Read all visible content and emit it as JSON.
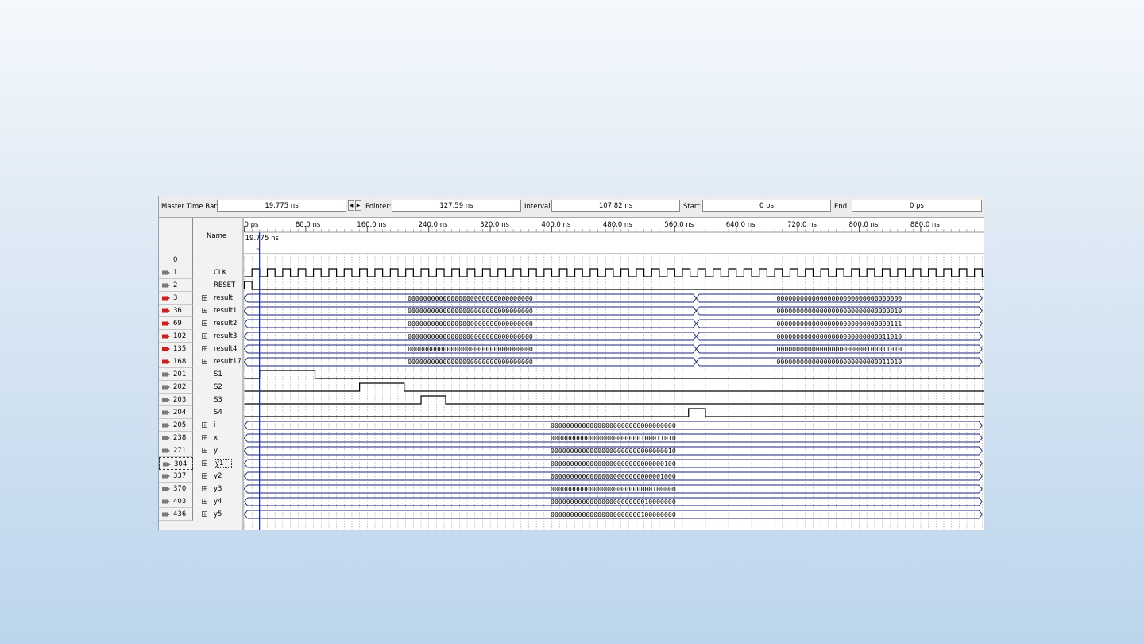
{
  "toolbar": {
    "master_label": "Master Time Bar:",
    "master_value": "19.775 ns",
    "pointer_label": "Pointer:",
    "pointer_value": "127.59 ns",
    "interval_label": "Interval:",
    "interval_value": "107.82 ns",
    "start_label": "Start:",
    "start_value": "0 ps",
    "end_label": "End:",
    "end_value": "0 ps"
  },
  "header": {
    "name_col": "Name",
    "cursor_label": "19.775 ns",
    "zero_row": "0"
  },
  "timeline": {
    "ticks": [
      "0 ps",
      "80.0 ns",
      "160.0 ns",
      "240.0 ns",
      "320.0 ns",
      "400.0 ns",
      "480.0 ns",
      "560.0 ns",
      "640.0 ns",
      "720.0 ns",
      "800.0 ns",
      "880.0 ns"
    ],
    "ns_per_tick": 80,
    "cursor_ns": 19.775,
    "clock_period_ns": 20
  },
  "signals": [
    {
      "idx": "1",
      "name": "CLK",
      "kind": "clock",
      "pin": "in"
    },
    {
      "idx": "2",
      "name": "RESET",
      "kind": "pulse",
      "pin": "in",
      "pulses": [
        [
          0,
          10
        ]
      ]
    },
    {
      "idx": "3",
      "name": "result",
      "kind": "bus",
      "pin": "out",
      "expand": true,
      "segments": [
        {
          "from": 0,
          "to": 588,
          "text": "00000000000000000000000000000000"
        },
        {
          "from": 588,
          "to": 960,
          "text": "00000000000000000000000000000000"
        }
      ]
    },
    {
      "idx": "36",
      "name": "result1",
      "kind": "bus",
      "pin": "out",
      "expand": true,
      "segments": [
        {
          "from": 0,
          "to": 588,
          "text": "00000000000000000000000000000000"
        },
        {
          "from": 588,
          "to": 960,
          "text": "00000000000000000000000000000010"
        }
      ]
    },
    {
      "idx": "69",
      "name": "result2",
      "kind": "bus",
      "pin": "out",
      "expand": true,
      "segments": [
        {
          "from": 0,
          "to": 588,
          "text": "00000000000000000000000000000000"
        },
        {
          "from": 588,
          "to": 960,
          "text": "00000000000000000000000000000111"
        }
      ]
    },
    {
      "idx": "102",
      "name": "result3",
      "kind": "bus",
      "pin": "out",
      "expand": true,
      "segments": [
        {
          "from": 0,
          "to": 588,
          "text": "00000000000000000000000000000000"
        },
        {
          "from": 588,
          "to": 960,
          "text": "00000000000000000000000000011010"
        }
      ]
    },
    {
      "idx": "135",
      "name": "result4",
      "kind": "bus",
      "pin": "out",
      "expand": true,
      "segments": [
        {
          "from": 0,
          "to": 588,
          "text": "00000000000000000000000000000000"
        },
        {
          "from": 588,
          "to": 960,
          "text": "00000000000000000000000100011010"
        }
      ]
    },
    {
      "idx": "168",
      "name": "result17",
      "kind": "bus",
      "pin": "out",
      "expand": true,
      "segments": [
        {
          "from": 0,
          "to": 588,
          "text": "00000000000000000000000000000000"
        },
        {
          "from": 588,
          "to": 960,
          "text": "00000000000000000000000000011010"
        }
      ]
    },
    {
      "idx": "201",
      "name": "S1",
      "kind": "pulse",
      "pin": "in",
      "pulses": [
        [
          20,
          92
        ]
      ]
    },
    {
      "idx": "202",
      "name": "S2",
      "kind": "pulse",
      "pin": "in",
      "pulses": [
        [
          150,
          208
        ]
      ]
    },
    {
      "idx": "203",
      "name": "S3",
      "kind": "pulse",
      "pin": "in",
      "pulses": [
        [
          230,
          262
        ]
      ]
    },
    {
      "idx": "204",
      "name": "S4",
      "kind": "pulse",
      "pin": "in",
      "pulses": [
        [
          578,
          600
        ]
      ]
    },
    {
      "idx": "205",
      "name": "i",
      "kind": "bus",
      "pin": "in",
      "expand": true,
      "segments": [
        {
          "from": 0,
          "to": 960,
          "text": "00000000000000000000000000000000"
        }
      ]
    },
    {
      "idx": "238",
      "name": "x",
      "kind": "bus",
      "pin": "in",
      "expand": true,
      "segments": [
        {
          "from": 0,
          "to": 960,
          "text": "00000000000000000000000100011010"
        }
      ]
    },
    {
      "idx": "271",
      "name": "y",
      "kind": "bus",
      "pin": "in",
      "expand": true,
      "segments": [
        {
          "from": 0,
          "to": 960,
          "text": "00000000000000000000000000000010"
        }
      ]
    },
    {
      "idx": "304",
      "name": "y1",
      "kind": "bus",
      "pin": "in",
      "expand": true,
      "selected": true,
      "segments": [
        {
          "from": 0,
          "to": 960,
          "text": "00000000000000000000000000000100"
        }
      ]
    },
    {
      "idx": "337",
      "name": "y2",
      "kind": "bus",
      "pin": "in",
      "expand": true,
      "segments": [
        {
          "from": 0,
          "to": 960,
          "text": "00000000000000000000000000001000"
        }
      ]
    },
    {
      "idx": "370",
      "name": "y3",
      "kind": "bus",
      "pin": "in",
      "expand": true,
      "segments": [
        {
          "from": 0,
          "to": 960,
          "text": "00000000000000000000000000100000"
        }
      ]
    },
    {
      "idx": "403",
      "name": "y4",
      "kind": "bus",
      "pin": "in",
      "expand": true,
      "segments": [
        {
          "from": 0,
          "to": 960,
          "text": "00000000000000000000000010000000"
        }
      ]
    },
    {
      "idx": "436",
      "name": "y5",
      "kind": "bus",
      "pin": "in",
      "expand": true,
      "segments": [
        {
          "from": 0,
          "to": 960,
          "text": "00000000000000000000000100000000"
        }
      ]
    }
  ],
  "colors": {
    "wave": "#000000",
    "bus_line": "#1a237e",
    "cursor": "#1f2aa0",
    "grid": "#9a9a9a",
    "pin_in": "#7a7a7a",
    "pin_out": "#cc2020"
  }
}
